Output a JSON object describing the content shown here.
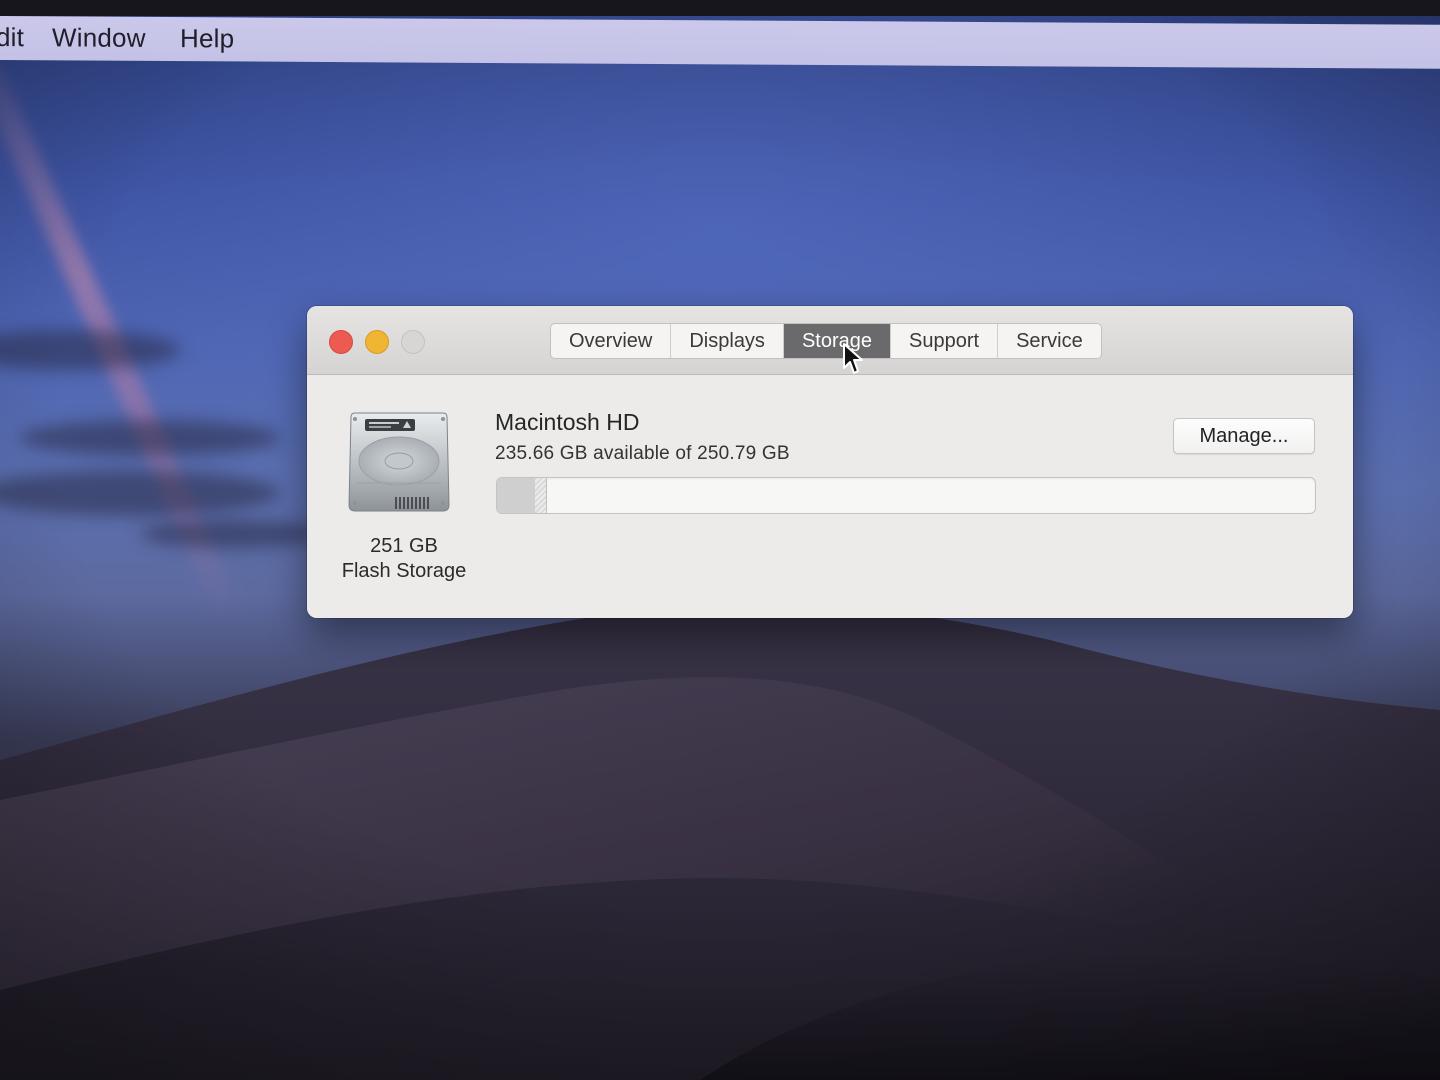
{
  "menubar": {
    "items": [
      "dit",
      "Window",
      "Help"
    ]
  },
  "window": {
    "tabs": [
      {
        "label": "Overview",
        "active": false
      },
      {
        "label": "Displays",
        "active": false
      },
      {
        "label": "Storage",
        "active": true
      },
      {
        "label": "Support",
        "active": false
      },
      {
        "label": "Service",
        "active": false
      }
    ],
    "traffic_lights": {
      "close_color": "#ec5a52",
      "minimize_color": "#f0b532",
      "zoom_color": "#d8d6d5"
    }
  },
  "storage": {
    "disk_icon": "hard-drive-icon",
    "disk_size": "251 GB",
    "disk_type": "Flash Storage",
    "volume_name": "Macintosh HD",
    "availability": "235.66 GB available of 250.79 GB",
    "usage_fraction_used": 0.047,
    "usage_fraction_other": 0.013,
    "manage_label": "Manage..."
  },
  "colors": {
    "active_tab": "#6a6a6c",
    "window_bg": "#ecebe9",
    "menubar_bg": "#c6c4e8"
  }
}
